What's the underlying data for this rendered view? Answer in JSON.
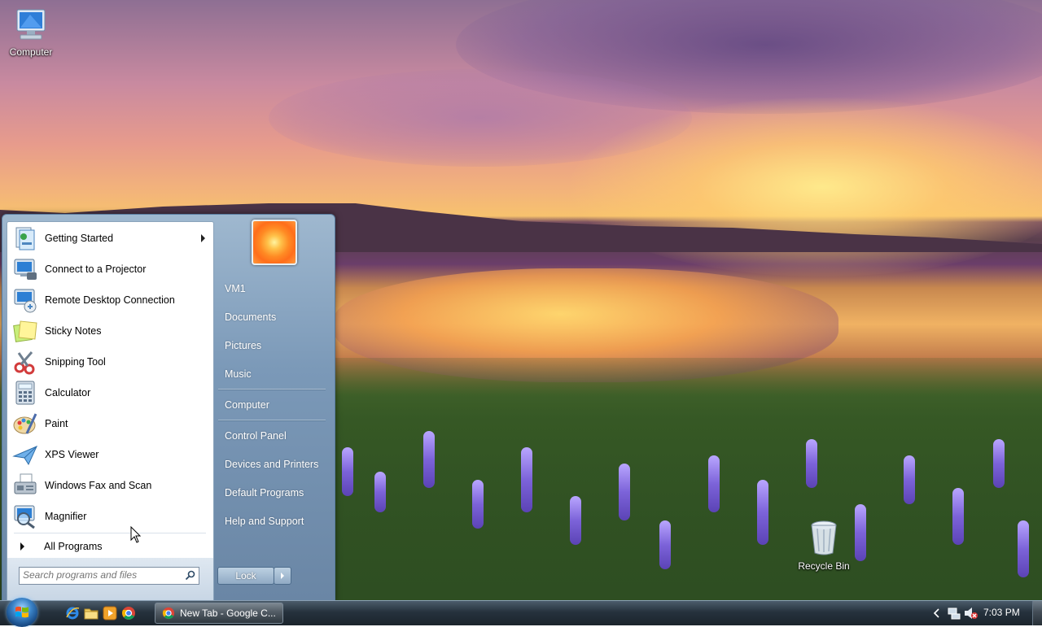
{
  "desktop": {
    "icons": [
      {
        "label": "Computer",
        "icon": "computer-icon"
      },
      {
        "label": "Recycle Bin",
        "icon": "recycle-bin-icon"
      }
    ]
  },
  "start_menu": {
    "programs": [
      {
        "label": "Getting Started",
        "icon": "getting-started-icon",
        "has_submenu": true
      },
      {
        "label": "Connect to a Projector",
        "icon": "projector-icon"
      },
      {
        "label": "Remote Desktop Connection",
        "icon": "remote-desktop-icon"
      },
      {
        "label": "Sticky Notes",
        "icon": "sticky-notes-icon"
      },
      {
        "label": "Snipping Tool",
        "icon": "snipping-tool-icon"
      },
      {
        "label": "Calculator",
        "icon": "calculator-icon"
      },
      {
        "label": "Paint",
        "icon": "paint-icon"
      },
      {
        "label": "XPS Viewer",
        "icon": "xps-viewer-icon"
      },
      {
        "label": "Windows Fax and Scan",
        "icon": "fax-scan-icon"
      },
      {
        "label": "Magnifier",
        "icon": "magnifier-icon"
      }
    ],
    "all_programs": "All Programs",
    "search_placeholder": "Search programs and files",
    "places": [
      {
        "label": "VM1"
      },
      {
        "label": "Documents"
      },
      {
        "label": "Pictures"
      },
      {
        "label": "Music"
      },
      {
        "label": "Computer"
      },
      {
        "label": "Control Panel"
      },
      {
        "label": "Devices and Printers"
      },
      {
        "label": "Default Programs"
      },
      {
        "label": "Help and Support"
      }
    ],
    "shutdown_label": "Lock"
  },
  "taskbar": {
    "quick_launch": [
      "internet-explorer-icon",
      "folder-icon",
      "media-player-icon",
      "chrome-icon"
    ],
    "tasks": [
      {
        "label": "New Tab - Google C...",
        "icon": "chrome-icon"
      }
    ],
    "tray_icons": [
      "show-hidden-icons-arrow-icon",
      "network-icon",
      "volume-muted-icon"
    ],
    "clock": "7:03 PM"
  },
  "colors": {
    "start_orb": "#3c84c8",
    "taskbar": "#26323d",
    "start_menu_right": "#7b99b8"
  }
}
